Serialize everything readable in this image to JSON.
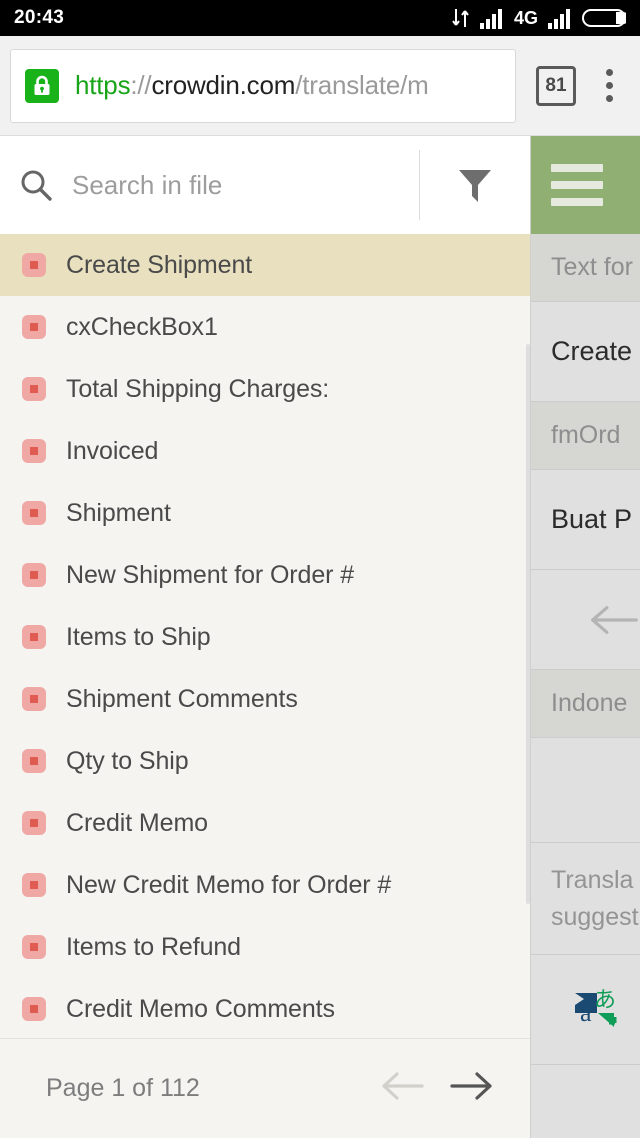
{
  "status_bar": {
    "clock": "20:43",
    "network_type": "4G",
    "icons": [
      "data-transfer-icon",
      "signal-bars-icon",
      "signal-bars-icon-2",
      "battery-icon"
    ]
  },
  "browser": {
    "lock_icon": "lock-icon",
    "url": {
      "scheme": "https",
      "separator": "://",
      "host": "crowdin.com",
      "path": "/translate/m"
    },
    "tab_count": "81",
    "menu_icon": "kebab-menu-icon"
  },
  "search": {
    "placeholder": "Search in file",
    "value": "",
    "icon": "search-icon",
    "filter_icon": "filter-funnel-icon"
  },
  "strings": [
    {
      "label": "Create Shipment",
      "selected": true
    },
    {
      "label": "cxCheckBox1",
      "selected": false
    },
    {
      "label": "Total Shipping Charges:",
      "selected": false
    },
    {
      "label": "Invoiced",
      "selected": false
    },
    {
      "label": "Shipment",
      "selected": false
    },
    {
      "label": "New Shipment for Order #",
      "selected": false
    },
    {
      "label": "Items to Ship",
      "selected": false
    },
    {
      "label": "Shipment Comments",
      "selected": false
    },
    {
      "label": "Qty to Ship",
      "selected": false
    },
    {
      "label": "Credit Memo",
      "selected": false
    },
    {
      "label": "New Credit Memo for Order #",
      "selected": false
    },
    {
      "label": "Items to Refund",
      "selected": false
    },
    {
      "label": "Credit Memo Comments",
      "selected": false
    }
  ],
  "pager": {
    "label": "Page 1 of 112",
    "prev_icon": "arrow-left-icon",
    "next_icon": "arrow-right-icon",
    "prev_enabled": false,
    "next_enabled": true
  },
  "translation_panel": {
    "menu_icon": "hamburger-menu-icon",
    "source_label": "Text for",
    "source_text": "Create",
    "context_label": "fmOrd",
    "translation_text": "Buat P",
    "back_icon": "arrow-left-icon",
    "target_language": "Indone",
    "suggestion_hint_line1": "Transla",
    "suggestion_hint_line2": "suggest",
    "machine_translation_icon": "google-translate-icon"
  },
  "colors": {
    "accent_green": "#8faf73",
    "selected_row": "#e9e0c0",
    "list_background": "#f5f4f0",
    "string_icon": "#f0a8a4",
    "string_icon_inner": "#e05b52",
    "panel_background": "#e0e0e0",
    "panel_label_background": "#d6d6d2",
    "lock_green": "#19b219"
  }
}
